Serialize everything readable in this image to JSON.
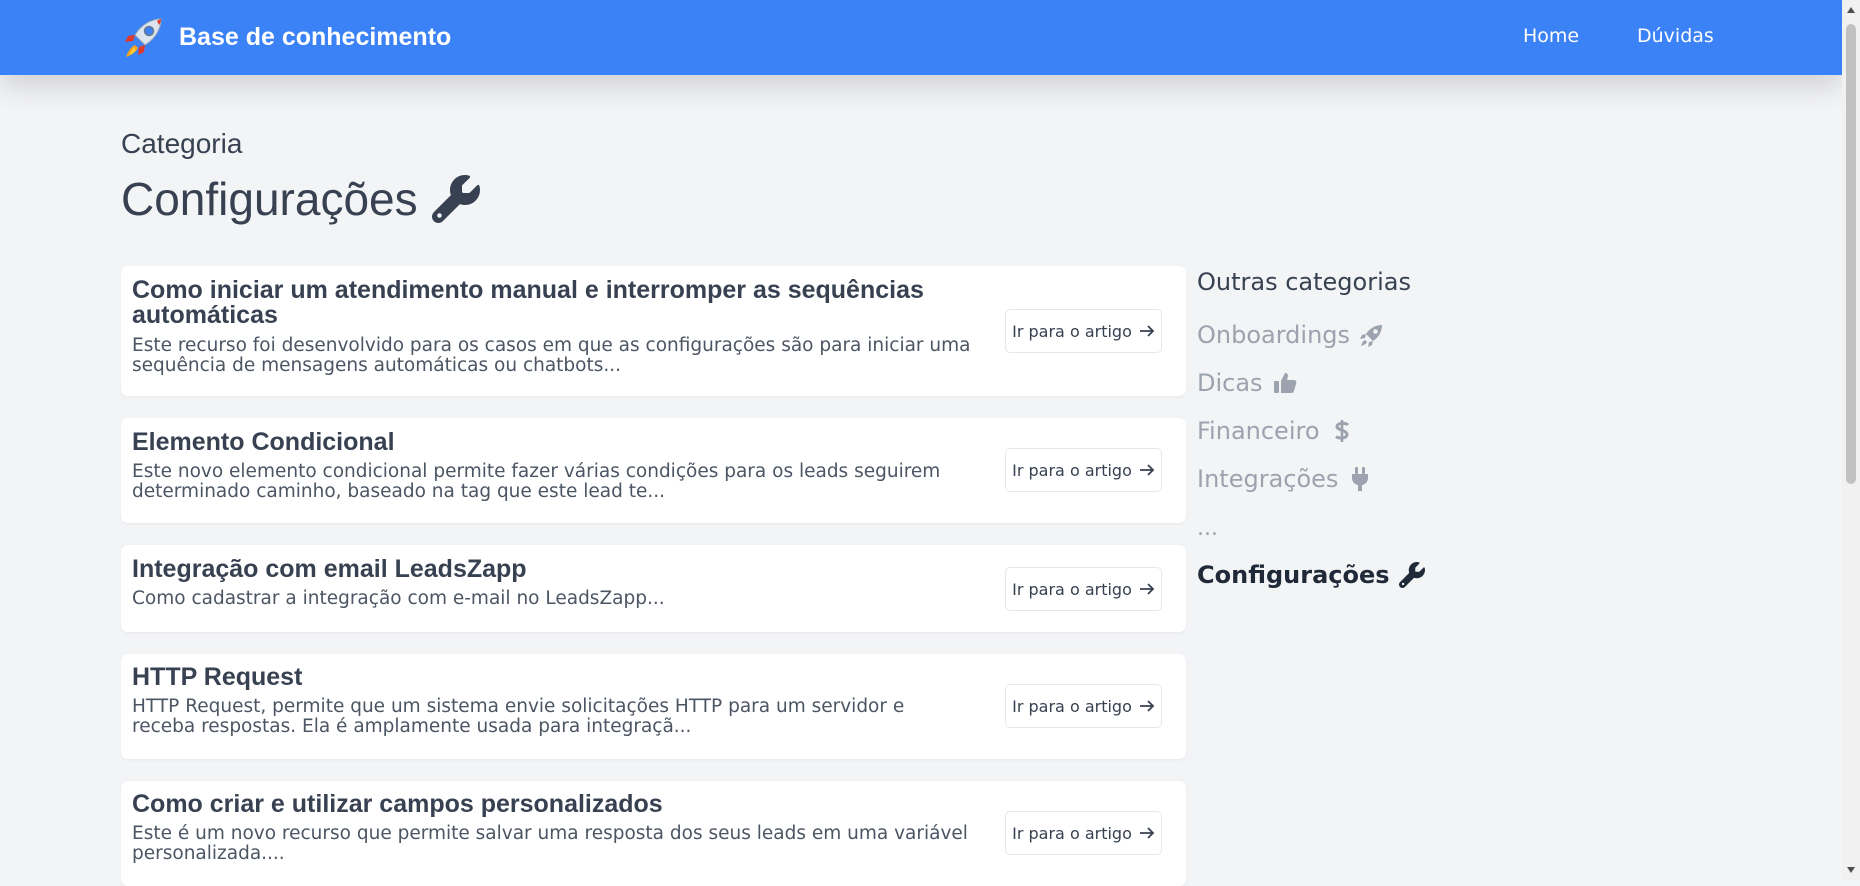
{
  "header": {
    "title": "Base de conhecimento",
    "logo_icon": "rocket-icon",
    "nav": [
      {
        "label": "Home"
      },
      {
        "label": "Dúvidas"
      }
    ],
    "color": "#3b82f6"
  },
  "page": {
    "eyebrow": "Categoria",
    "title": "Configurações",
    "title_icon": "wrench-icon"
  },
  "articles": [
    {
      "title": "Como iniciar um atendimento manual e interromper as sequências automáticas",
      "description": "Este recurso foi desenvolvido para os casos em que as configurações são para iniciar uma sequência de mensagens automáticas ou chatbots...",
      "button": "Ir para o artigo"
    },
    {
      "title": "Elemento Condicional",
      "description": "Este novo elemento condicional permite fazer várias condições para os leads seguirem determinado caminho, baseado na tag que este lead te...",
      "button": "Ir para o artigo"
    },
    {
      "title": "Integração com email LeadsZapp",
      "description": "Como cadastrar a integração com e-mail no LeadsZapp...",
      "button": "Ir para o artigo"
    },
    {
      "title": "HTTP Request",
      "description": "HTTP Request, permite que um sistema envie solicitações HTTP para um servidor e receba respostas. Ela é amplamente usada para integraçã...",
      "button": "Ir para o artigo"
    },
    {
      "title": "Como criar e utilizar campos personalizados",
      "description": "Este é um novo recurso que permite salvar uma resposta dos seus leads em uma variável personalizada....",
      "button": "Ir para o artigo"
    }
  ],
  "sidebar": {
    "heading": "Outras categorias",
    "items": [
      {
        "label": "Onboardings",
        "icon": "rocket-icon"
      },
      {
        "label": "Dicas",
        "icon": "thumbs-up-icon"
      },
      {
        "label": "Financeiro",
        "icon": "dollar-icon"
      },
      {
        "label": "Integrações",
        "icon": "plug-icon"
      },
      {
        "label": "..."
      },
      {
        "label": "Configurações",
        "icon": "wrench-icon",
        "active": true
      }
    ]
  }
}
